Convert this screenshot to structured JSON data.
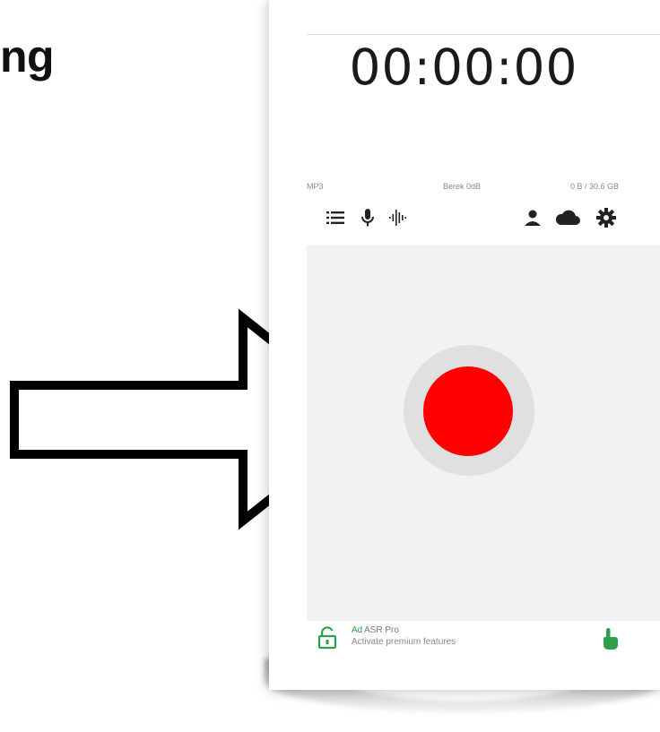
{
  "heading_fragment": "ng",
  "recorder": {
    "timer": "00:00:00",
    "info": {
      "format": "MP3",
      "gain": "Berek 0dB",
      "storage": "0 B / 30.6 GB"
    },
    "toolbar_icons": [
      "list-icon",
      "microphone-icon",
      "waveform-icon",
      "user-icon",
      "cloud-icon",
      "gear-icon"
    ],
    "record_color": "#ff0000",
    "ad": {
      "badge": "Ad",
      "title": "ASR Pro",
      "subtitle": "Activate premium features"
    }
  },
  "colors": {
    "accent_green": "#2e9e4a",
    "record_red": "#ff0000",
    "ring_gray": "#e0e0e0"
  }
}
